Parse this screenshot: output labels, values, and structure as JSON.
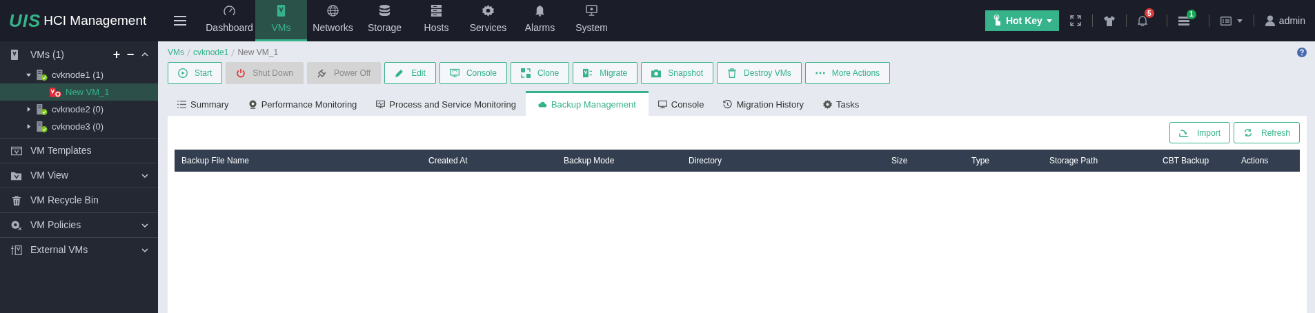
{
  "brand": {
    "logo": "UIS",
    "title": "HCI Management"
  },
  "nav": [
    {
      "label": "Dashboard",
      "selected": false
    },
    {
      "label": "VMs",
      "selected": true
    },
    {
      "label": "Networks",
      "selected": false
    },
    {
      "label": "Storage",
      "selected": false
    },
    {
      "label": "Hosts",
      "selected": false
    },
    {
      "label": "Services",
      "selected": false
    },
    {
      "label": "Alarms",
      "selected": false
    },
    {
      "label": "System",
      "selected": false
    }
  ],
  "header": {
    "hotkey": "Hot Key",
    "alarm_count": "5",
    "task_count": "1",
    "user": "admin"
  },
  "sidebar": {
    "title": "VMs (1)",
    "add": "+",
    "remove": "−",
    "expanded": true,
    "tree": [
      {
        "label": "cvknode1 (1)",
        "kind": "host",
        "expanded": true,
        "selected": false,
        "children": [
          {
            "label": "New VM_1",
            "kind": "vm",
            "selected": true
          }
        ]
      },
      {
        "label": "cvknode2 (0)",
        "kind": "host",
        "expanded": false,
        "selected": false
      },
      {
        "label": "cvknode3 (0)",
        "kind": "host",
        "expanded": false,
        "selected": false
      }
    ],
    "items": [
      {
        "label": "VM Templates",
        "kind": "link"
      },
      {
        "label": "VM View",
        "kind": "group",
        "expanded": false
      },
      {
        "label": "VM Recycle Bin",
        "kind": "link"
      },
      {
        "label": "VM Policies",
        "kind": "group",
        "expanded": false
      },
      {
        "label": "External VMs",
        "kind": "group",
        "expanded": false
      }
    ]
  },
  "breadcrumb": [
    {
      "label": "VMs",
      "kind": "link"
    },
    {
      "label": "cvknode1",
      "kind": "link"
    },
    {
      "label": "New VM_1",
      "kind": "current"
    }
  ],
  "actions": [
    {
      "label": "Start",
      "disabled": false
    },
    {
      "label": "Shut Down",
      "disabled": true
    },
    {
      "label": "Power Off",
      "disabled": true
    },
    {
      "label": "Edit",
      "disabled": false
    },
    {
      "label": "Console",
      "disabled": false
    },
    {
      "label": "Clone",
      "disabled": false
    },
    {
      "label": "Migrate",
      "disabled": false
    },
    {
      "label": "Snapshot",
      "disabled": false
    },
    {
      "label": "Destroy VMs",
      "disabled": false
    },
    {
      "label": "More Actions",
      "disabled": false
    }
  ],
  "tabs": [
    {
      "label": "Summary",
      "selected": false
    },
    {
      "label": "Performance Monitoring",
      "selected": false
    },
    {
      "label": "Process and Service Monitoring",
      "selected": false
    },
    {
      "label": "Backup Management",
      "selected": true
    },
    {
      "label": "Console",
      "selected": false
    },
    {
      "label": "Migration History",
      "selected": false
    },
    {
      "label": "Tasks",
      "selected": false
    }
  ],
  "panel_buttons": [
    "Import",
    "Refresh"
  ],
  "table": {
    "columns": [
      "Backup File Name",
      "Created At",
      "Backup Mode",
      "Directory",
      "Size",
      "Type",
      "Storage Path",
      "CBT Backup",
      "Actions"
    ]
  }
}
